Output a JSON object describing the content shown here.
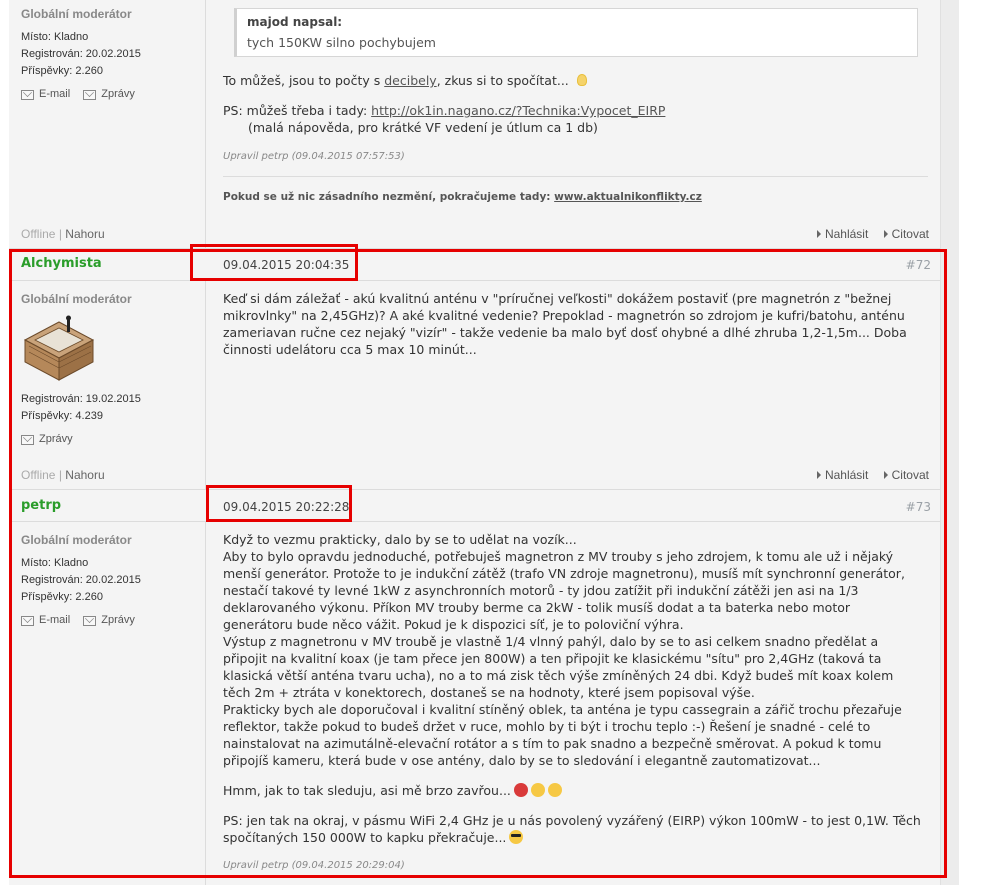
{
  "colors": {
    "username": "#2a9d2a",
    "highlight": "#e60000",
    "panel": "#f4f4f4"
  },
  "post_top": {
    "rank": "Globální moderátor",
    "location": "Místo: Kladno",
    "registered": "Registrován: 20.02.2015",
    "posts": "Příspěvky: 2.260",
    "email_label": "E-mail",
    "messages_label": "Zprávy",
    "quote_author": "majod napsal:",
    "quote_text": "tych 150KW silno pochybujem",
    "line1_pre": "To můžeš, jsou to počty s ",
    "line1_link": "decibely",
    "line1_post": ", zkus si to spočítat...",
    "line2_pre": "PS: můžeš třeba i tady: ",
    "line2_link": "http://ok1in.nagano.cz/?Technika:Vypocet_EIRP",
    "line3": "(malá nápověda, pro krátké VF vedení je útlum ca 1 db)",
    "edited": "Upravil petrp (09.04.2015 07:57:53)",
    "signature_pre": "Pokud se už nic zásadního nezmění, pokračujeme tady: ",
    "signature_link": "www.aktualnikonflikty.cz",
    "offline": "Offline",
    "separator": "|",
    "top_link": "Nahoru",
    "report": "Nahlásit",
    "quote_action": "Citovat"
  },
  "post72": {
    "username": "Alchymista",
    "date": "09.04.2015 20:04:35",
    "number": "#72",
    "rank": "Globální moderátor",
    "registered": "Registrován: 19.02.2015",
    "posts": "Příspěvky: 4.239",
    "messages_label": "Zprávy",
    "text": "Keď si dám záležať - akú kvalitnú anténu v \"príručnej veľkosti\" dokážem postaviť (pre magnetrón z \"bežnej mikrovlnky\" na 2,45GHz)? A aké kvalitné vedenie? Prepoklad - magnetrón so zdrojom je kufri/batohu, anténu zameriavan ručne cez nejaký \"vizír\" - takže vedenie ba malo byť dosť ohybné a dlhé zhruba 1,2-1,5m... Doba činnosti udelátoru cca 5 max 10 minút...",
    "offline": "Offline",
    "separator": "|",
    "top_link": "Nahoru",
    "report": "Nahlásit",
    "quote_action": "Citovat"
  },
  "post73": {
    "username": "petrp",
    "date": "09.04.2015 20:22:28",
    "number": "#73",
    "rank": "Globální moderátor",
    "location": "Místo: Kladno",
    "registered": "Registrován: 20.02.2015",
    "posts": "Příspěvky: 2.260",
    "email_label": "E-mail",
    "messages_label": "Zprávy",
    "para1": "Když to vezmu prakticky, dalo by se to udělat na vozík...\nAby to bylo opravdu jednoduché, potřebuješ magnetron z MV trouby s jeho zdrojem, k tomu ale už i nějaký menší generátor. Protože to je indukční zátěž (trafo VN zdroje magnetronu), musíš mít synchronní generátor, nestačí takové ty levné 1kW z asynchronních motorů - ty jdou zatížit při indukční zátěži jen asi na 1/3 deklarovaného výkonu. Příkon MV trouby berme ca 2kW - tolik musíš dodat a ta baterka nebo motor generátoru bude něco vážit. Pokud je k dispozici síť, je to poloviční výhra.\nVýstup z magnetronu v MV troubě je vlastně 1/4 vlnný pahýl, dalo by se to asi celkem snadno předělat a připojit na kvalitní koax (je tam přece jen 800W) a ten připojit ke klasickému \"sítu\" pro 2,4GHz (taková ta klasická větší anténa tvaru ucha), no a to má zisk těch výše zmíněných 24 dbi. Když budeš mít koax kolem těch 2m + ztráta v konektorech, dostaneš se na hodnoty, které jsem popisoval výše.\nPrakticky bych ale doporučoval i kvalitní stíněný oblek, ta anténa je typu cassegrain a zářič trochu přezařuje reflektor, takže pokud to budeš držet v ruce, mohlo by ti být i trochu teplo :-) Řešení je snadné - celé to nainstalovat na azimutálně-elevační rotátor a s tím to pak snadno a bezpečně směrovat. A pokud k tomu připojíš kameru, která bude v ose antény, dalo by se to sledování i elegantně zautomatizovat...",
    "para2": "Hmm, jak to tak sleduju, asi mě brzo zavřou...",
    "para3": "PS: jen tak na okraj, v pásmu WiFi 2,4 GHz je u nás povolený vyzářený (EIRP) výkon 100mW - to jest 0,1W. Těch spočítaných 150 000W to kapku překračuje...",
    "edited": "Upravil petrp (09.04.2015 20:29:04)"
  }
}
